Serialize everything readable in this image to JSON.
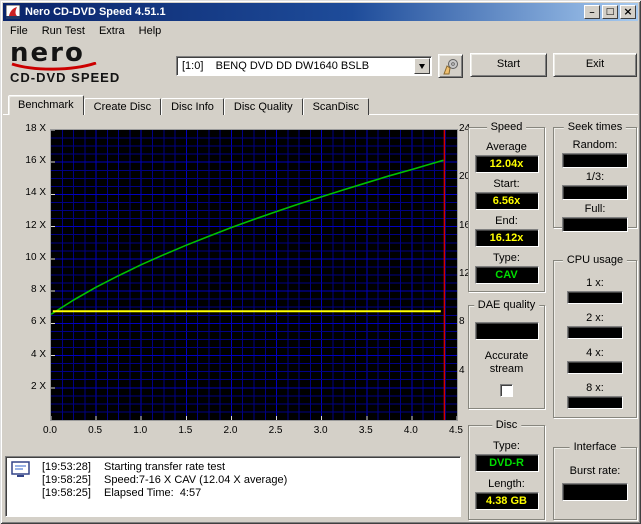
{
  "window": {
    "title": "Nero CD-DVD Speed 4.51.1"
  },
  "icons": {
    "minimize": "_",
    "maximize": "□",
    "close": "×"
  },
  "menu": {
    "items": [
      "File",
      "Run Test",
      "Extra",
      "Help"
    ]
  },
  "header": {
    "logo_top": "nero",
    "logo_bottom": "CD-DVD SPEED",
    "drive": "[1:0]    BENQ DVD DD DW1640 BSLB",
    "start_label": "Start",
    "exit_label": "Exit"
  },
  "tabs": [
    {
      "label": "Benchmark",
      "active": true
    },
    {
      "label": "Create Disc",
      "active": false
    },
    {
      "label": "Disc Info",
      "active": false
    },
    {
      "label": "Disc Quality",
      "active": false
    },
    {
      "label": "ScanDisc",
      "active": false
    }
  ],
  "chart_data": {
    "type": "line",
    "xlim": [
      0,
      4.5
    ],
    "ylim_left": [
      0,
      18
    ],
    "ylim_right": [
      0,
      24
    ],
    "x_ticks": [
      {
        "v": 0,
        "label": "0.0"
      },
      {
        "v": 0.5,
        "label": "0.5"
      },
      {
        "v": 1,
        "label": "1.0"
      },
      {
        "v": 1.5,
        "label": "1.5"
      },
      {
        "v": 2,
        "label": "2.0"
      },
      {
        "v": 2.5,
        "label": "2.5"
      },
      {
        "v": 3,
        "label": "3.0"
      },
      {
        "v": 3.5,
        "label": "3.5"
      },
      {
        "v": 4,
        "label": "4.0"
      },
      {
        "v": 4.5,
        "label": "4.5"
      }
    ],
    "y_left": [
      {
        "v": 18,
        "label": "18 X"
      },
      {
        "v": 16,
        "label": "16 X"
      },
      {
        "v": 14,
        "label": "14 X"
      },
      {
        "v": 12,
        "label": "12 X"
      },
      {
        "v": 10,
        "label": "10 X"
      },
      {
        "v": 8,
        "label": "8 X"
      },
      {
        "v": 6,
        "label": "6 X"
      },
      {
        "v": 4,
        "label": "4 X"
      },
      {
        "v": 2,
        "label": "2 X"
      }
    ],
    "y_right": [
      {
        "v": 24,
        "label": "24"
      },
      {
        "v": 20,
        "label": "20"
      },
      {
        "v": 16,
        "label": "16"
      },
      {
        "v": 12,
        "label": "12"
      },
      {
        "v": 8,
        "label": "8"
      },
      {
        "v": 4,
        "label": "4"
      }
    ],
    "bg": "#000000",
    "grid_minor": "#000084",
    "grid_major": "#0000be",
    "series": [
      {
        "name": "read-speed",
        "axis": "left",
        "color": "#00c000",
        "width": 1.6,
        "x": [
          0,
          0.25,
          0.5,
          0.75,
          1,
          1.25,
          1.5,
          1.75,
          2,
          2.25,
          2.5,
          2.75,
          3,
          3.25,
          3.5,
          3.75,
          4,
          4.25,
          4.35
        ],
        "y": [
          6.56,
          7.45,
          8.24,
          8.96,
          9.64,
          10.26,
          10.85,
          11.41,
          11.95,
          12.45,
          12.94,
          13.41,
          13.86,
          14.3,
          14.73,
          15.16,
          15.55,
          15.96,
          16.12
        ]
      },
      {
        "name": "rotation-speed",
        "axis": "right",
        "color": "#ffff00",
        "width": 2,
        "x": [
          0.02,
          4.32
        ],
        "y": [
          9,
          9
        ]
      },
      {
        "name": "end-marker",
        "color": "#d40000",
        "width": 1.4,
        "marker_x": 4.36
      }
    ]
  },
  "sidebar": {
    "speed": {
      "title": "Speed",
      "average_label": "Average",
      "average": "12.04x",
      "start_label": "Start:",
      "start": "6.56x",
      "end_label": "End:",
      "end": "16.12x",
      "type_label": "Type:",
      "type": "CAV"
    },
    "seek": {
      "title": "Seek times",
      "random_label": "Random:",
      "third_label": "1/3:",
      "full_label": "Full:"
    },
    "cpu": {
      "title": "CPU usage",
      "labels": [
        "1 x:",
        "2 x:",
        "4 x:",
        "8 x:"
      ]
    },
    "dae": {
      "title": "DAE quality",
      "accurate_label": "Accurate stream"
    },
    "disc": {
      "title": "Disc",
      "type_label": "Type:",
      "type": "DVD-R",
      "length_label": "Length:",
      "length": "4.38 GB"
    },
    "iface": {
      "title": "Interface",
      "burst_label": "Burst rate:"
    }
  },
  "log": {
    "lines": [
      {
        "time": "[19:53:28]",
        "text": "Starting transfer rate test"
      },
      {
        "time": "[19:58:25]",
        "text": "Speed:7-16 X CAV (12.04 X average)"
      },
      {
        "time": "[19:58:25]",
        "text": "Elapsed Time:  4:57"
      }
    ]
  },
  "colors": {
    "value_yellow": "#ffff00",
    "value_green": "#00dd00",
    "titlebar_left": "#0a246a",
    "titlebar_right": "#a6caf0",
    "chart_bg": "#000000"
  }
}
